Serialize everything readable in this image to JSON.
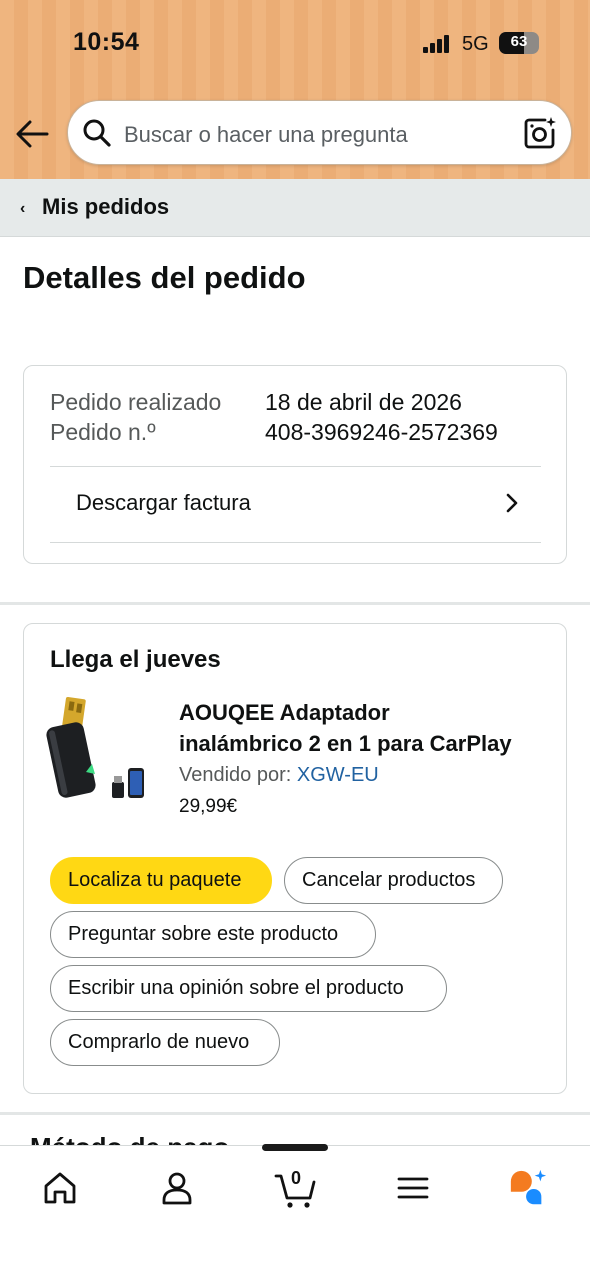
{
  "status_bar": {
    "time": "10:54",
    "network": "5G",
    "battery": "63",
    "battery_level": 0.63
  },
  "header": {
    "search_placeholder": "Buscar o hacer una pregunta"
  },
  "breadcrumb": {
    "label": "Mis pedidos"
  },
  "page": {
    "title": "Detalles del pedido"
  },
  "order_info": {
    "placed_label": "Pedido realizado",
    "placed_value": "18 de abril de 2026",
    "number_label": "Pedido n.º",
    "number_value": "408-3969246-2572369",
    "invoice_label": "Descargar factura"
  },
  "delivery": {
    "arrival": "Llega el jueves",
    "product": {
      "title_line1": "AOUQEE Adaptador",
      "title_line2": "inalámbrico 2 en 1 para CarPlay",
      "sold_by_label": "Vendido por:",
      "seller": "XGW-EU",
      "price": "29,99€"
    },
    "actions": {
      "track": "Localiza tu paquete",
      "cancel": "Cancelar productos",
      "ask": "Preguntar sobre este producto",
      "review": "Escribir una opinión sobre el producto",
      "buy_again": "Comprarlo de nuevo"
    }
  },
  "next_section_peek": "Método de pago",
  "bottom_nav": {
    "items": [
      "home-icon",
      "account-icon",
      "cart-icon",
      "menu-icon",
      "rufus-icon"
    ],
    "cart_count": "0"
  },
  "colors": {
    "header": "#efb57f",
    "primary_button": "#ffd814",
    "link": "#2162a1",
    "rufus_orange": "#f47b20",
    "rufus_blue": "#1a8cff"
  }
}
